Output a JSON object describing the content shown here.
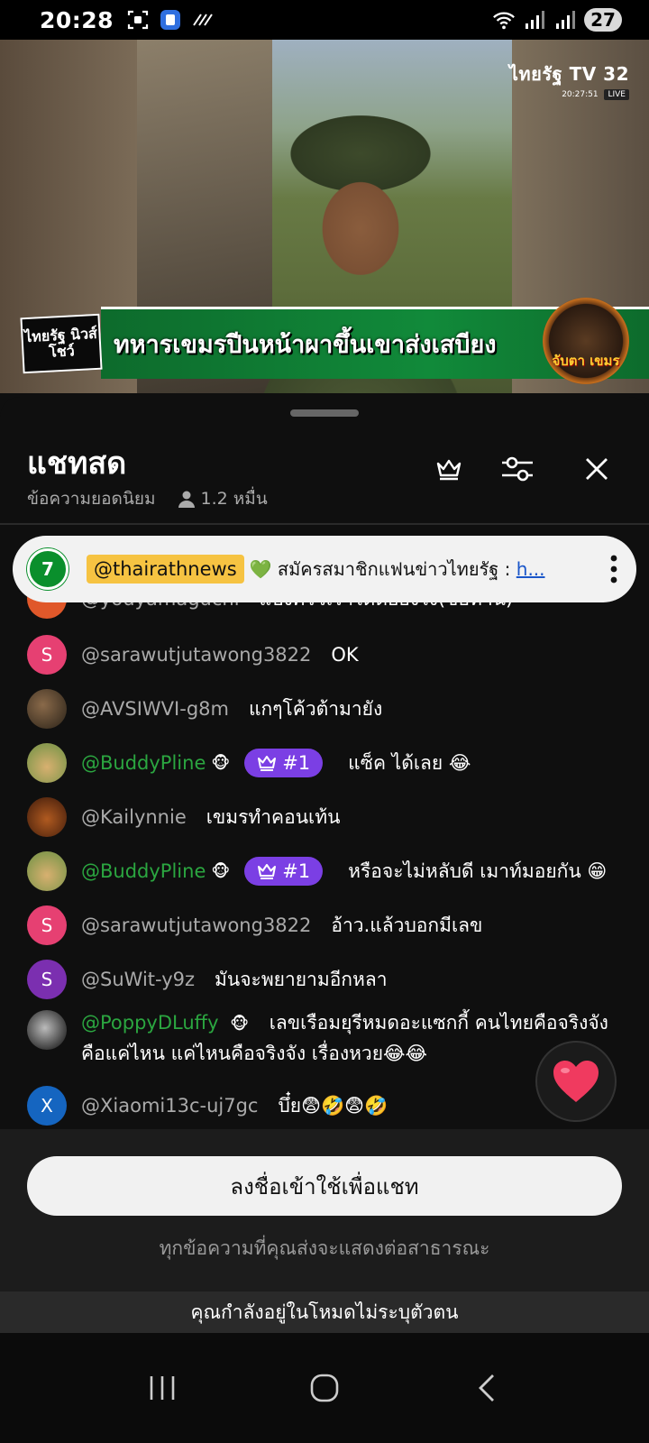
{
  "status_bar": {
    "time": "20:28",
    "battery": "27"
  },
  "video": {
    "channel_name": "ไทยรัฐ TV 32",
    "channel_time": "20:27:51",
    "live_label": "LIVE",
    "show_logo": "ไทยรัฐ นิวส์โชว์",
    "headline": "ทหารเขมรปีนหน้าผาขึ้นเขาส่งเสบียง",
    "badge_text": "จับตา เขมร"
  },
  "chat": {
    "title": "แชทสด",
    "mode": "ข้อความยอดนิยม",
    "viewers": "1.2 หมื่น",
    "pinned": {
      "avatar_text": "7",
      "author": "@thairathnews",
      "text": "💚 สมัครสมาชิกแฟนข่าวไทยรัฐ : ",
      "link": "h..."
    },
    "partial_message": {
      "author": "@youyamaguchi",
      "text": "แบ่งครัวเราได้ต่อยังไง(ขอทาน)"
    },
    "messages": [
      {
        "author": "@sarawutjutawong3822",
        "text": "OK",
        "avatar_letter": "S"
      },
      {
        "author": "@AVSIWVI-g8m",
        "text": "แกๆโค้วต้ามายัง",
        "avatar_letter": ""
      },
      {
        "author": "@BuddyPline",
        "badge_emoji": "🐵",
        "rank": "#1",
        "text": "แซ็ค ได้เลย 😂",
        "avatar_letter": ""
      },
      {
        "author": "@Kailynnie",
        "text": "เขมรทำคอนเท้น",
        "avatar_letter": ""
      },
      {
        "author": "@BuddyPline",
        "badge_emoji": "🐵",
        "rank": "#1",
        "text": "หรือจะไม่หลับดี เมาท์มอยกัน 😁",
        "avatar_letter": ""
      },
      {
        "author": "@sarawutjutawong3822",
        "text": "อ้าว.แล้วบอกมีเลข",
        "avatar_letter": "S"
      },
      {
        "author": "@SuWit-y9z",
        "text": "มันจะพยายามอีกหลา",
        "avatar_letter": "S"
      },
      {
        "author": "@PoppyDLuffy",
        "badge_emoji": "🐵",
        "text": "เลขเรือมยุรีหมดอะแซกกี้ คนไทยคือจริงจังคือแค่ไหน แค่ไหนคือจริงจัง เรื่องหวย😂😂",
        "avatar_letter": ""
      },
      {
        "author": "@Xiaomi13c-uj7gc",
        "text": "บึ๋ย😨🤣😨🤣",
        "avatar_letter": "X"
      }
    ],
    "signin_button": "ลงชื่อเข้าใช้เพื่อแชท",
    "public_note": "ทุกข้อความที่คุณส่งจะแสดงต่อสาธารณะ",
    "anon_notice": "คุณกำลังอยู่ในโหมดไม่ระบุตัวตน"
  },
  "colors": {
    "member_name": "#2ba640",
    "rank_badge": "#7b3fe4",
    "pinned_author_bg": "#f6c342"
  }
}
